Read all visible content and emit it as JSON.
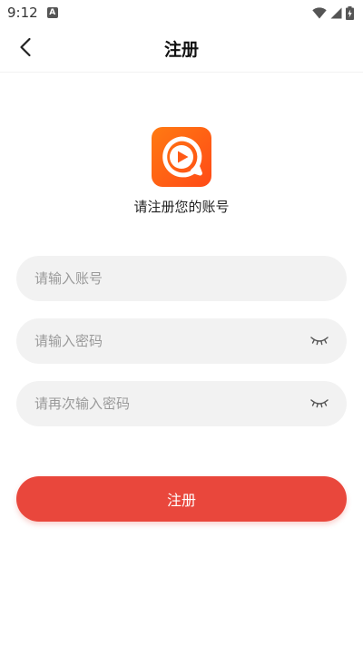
{
  "status_bar": {
    "time": "9:12",
    "notification_icon": "a-letter-icon",
    "icons": [
      "wifi-icon",
      "signal-icon",
      "battery-charging-icon"
    ]
  },
  "nav": {
    "back_icon": "chevron-left-icon",
    "title": "注册"
  },
  "logo": {
    "icon": "play-circle-logo",
    "colors": {
      "gradient_start": "#ff7a12",
      "gradient_end": "#ff4a17"
    }
  },
  "subtitle": "请注册您的账号",
  "form": {
    "account": {
      "placeholder": "请输入账号",
      "value": ""
    },
    "password": {
      "placeholder": "请输入密码",
      "value": "",
      "toggle_icon": "eye-closed-icon"
    },
    "confirm_password": {
      "placeholder": "请再次输入密码",
      "value": "",
      "toggle_icon": "eye-closed-icon"
    }
  },
  "register_button": {
    "label": "注册",
    "color": "#e9473c"
  }
}
